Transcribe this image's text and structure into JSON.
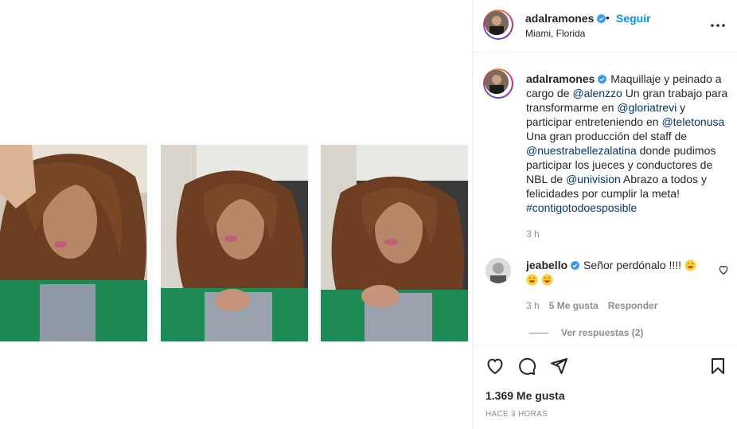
{
  "post": {
    "username": "adalramones",
    "dot": "•",
    "follow_label": "Seguir",
    "location": "Miami, Florida",
    "icons": {
      "verified": "verified-badge-icon",
      "more": "more-options-icon"
    }
  },
  "caption": {
    "username": "adalramones",
    "t1": " Maquillaje y peinado a cargo de ",
    "tag1": "@alenzzo",
    "t2": " Un gran trabajo para transformarme en ",
    "tag2": "@gloriatrevi",
    "t3": " y participar entreteniendo en ",
    "tag3": "@teletonusa",
    "t4": " Una gran producción del staff de ",
    "tag4": "@nuestrabellezalatina",
    "t5": " donde pudimos participar los jueces y conductores de NBL de ",
    "tag5": "@univision",
    "t6": " Abrazo a todos y felicidades por cumplir la meta! ",
    "hashtag": "#contigotodoesposible",
    "time": "3 h"
  },
  "comment": {
    "username": "jeabello",
    "text": " Señor perdónalo !!!! ",
    "time": "3 h",
    "likes": "5 Me gusta",
    "reply_label": "Responder",
    "view_replies": "Ver respuestas (2)"
  },
  "footer": {
    "likes": "1.369 Me gusta",
    "time_ago": "HACE 3 HORAS"
  },
  "colors": {
    "link_blue": "#0095f6",
    "tag_blue": "#00376b",
    "muted": "#8e8e8e"
  }
}
